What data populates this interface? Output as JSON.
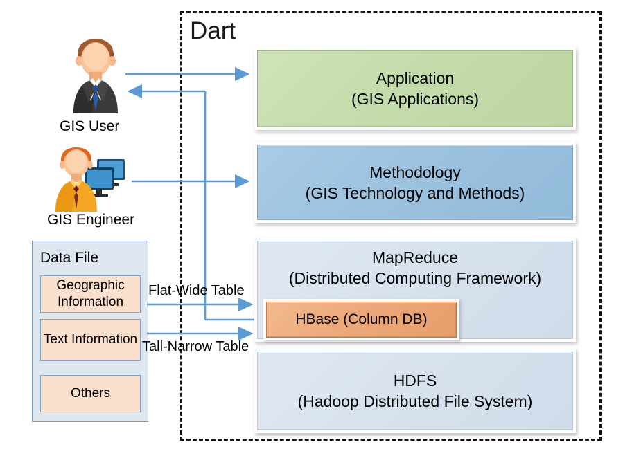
{
  "diagram": {
    "container": {
      "label": "Dart",
      "style": "dashed-border"
    },
    "actors": [
      {
        "id": "gis-user",
        "label": "GIS User",
        "icon": "businessman-avatar-icon"
      },
      {
        "id": "gis-engineer",
        "label": "GIS Engineer",
        "icon": "engineer-with-monitors-avatar-icon"
      }
    ],
    "data_file": {
      "title": "Data File",
      "items": [
        {
          "label": "Geographic Information"
        },
        {
          "label": "Text Information"
        },
        {
          "label": "Others"
        }
      ]
    },
    "layers": [
      {
        "id": "application",
        "title": "Application",
        "subtitle": "(GIS Applications)",
        "color": "#c5dcac"
      },
      {
        "id": "methodology",
        "title": "Methodology",
        "subtitle": "(GIS Technology and Methods)",
        "color": "#9dc3e0"
      },
      {
        "id": "mapreduce",
        "title": "MapReduce",
        "subtitle": "(Distributed Computing Framework)",
        "color": "#d8e2ee"
      },
      {
        "id": "hdfs",
        "title": "HDFS",
        "subtitle": "(Hadoop Distributed File System)",
        "color": "#d8e2ee"
      }
    ],
    "hbase": {
      "label": "HBase (Column DB)",
      "color": "#eda97a"
    },
    "edge_labels": [
      {
        "id": "flat-wide",
        "label": "Flat-Wide Table"
      },
      {
        "id": "tall-narrow",
        "label": "Tall-Narrow Table"
      }
    ],
    "colors": {
      "arrow": "#5b9bd5",
      "dashed_border": "#111111",
      "data_file_fill": "#dfe7f1",
      "data_file_item_fill": "#fbe0cd"
    }
  }
}
